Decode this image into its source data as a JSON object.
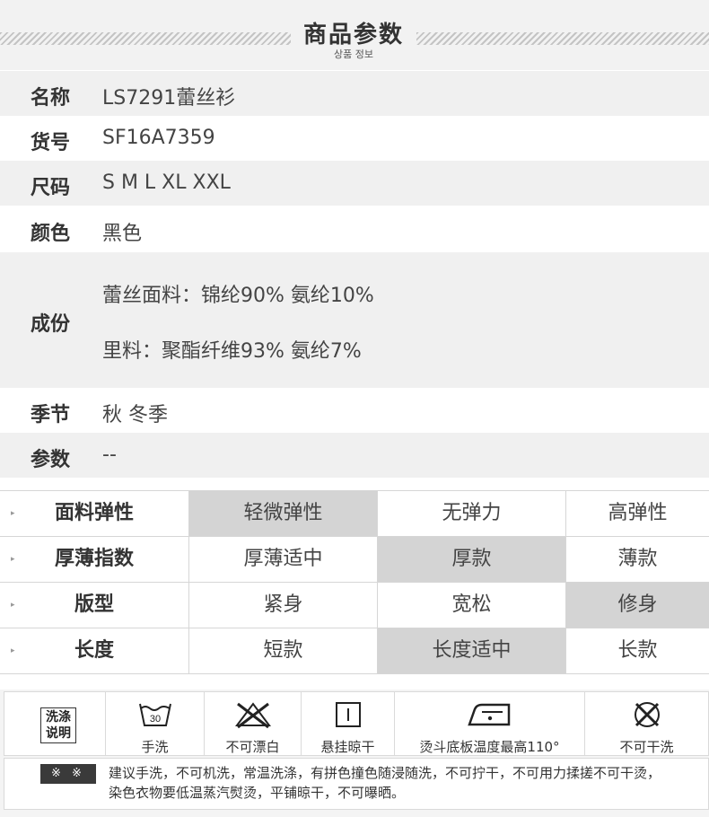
{
  "header": {
    "title": "商品参数",
    "subtitle": "상품 정보"
  },
  "info": [
    {
      "label": "名称",
      "value": "LS7291蕾丝衫"
    },
    {
      "label": "货号",
      "value": "SF16A7359"
    },
    {
      "label": "尺码",
      "value": "S M L XL XXL"
    },
    {
      "label": "颜色",
      "value": "黑色"
    },
    {
      "label": "成份",
      "lines": [
        "蕾丝面料：锦纶90% 氨纶10%",
        "里料：聚酯纤维93% 氨纶7%"
      ]
    },
    {
      "label": "季节",
      "value": "秋 冬季"
    },
    {
      "label": "参数",
      "value": "--"
    }
  ],
  "attributes": [
    {
      "name": "面料弹性",
      "options": [
        "轻微弹性",
        "无弹力",
        "高弹性"
      ],
      "selected": 0
    },
    {
      "name": "厚薄指数",
      "options": [
        "厚薄适中",
        "厚款",
        "薄款"
      ],
      "selected": 1
    },
    {
      "name": "版型",
      "options": [
        "紧身",
        "宽松",
        "修身"
      ],
      "selected": 2
    },
    {
      "name": "长度",
      "options": [
        "短款",
        "长度适中",
        "长款"
      ],
      "selected": 1
    }
  ],
  "care": {
    "badge": [
      "洗涤",
      "说明"
    ],
    "items": [
      {
        "icon": "hand-wash-30-icon",
        "icon_text": "30",
        "label": "手洗"
      },
      {
        "icon": "no-bleach-icon",
        "label": "不可漂白"
      },
      {
        "icon": "hang-dry-icon",
        "label": "悬挂晾干"
      },
      {
        "icon": "iron-icon",
        "label": "烫斗底板温度最高110°"
      },
      {
        "icon": "no-dry-clean-icon",
        "label": "不可干洗"
      }
    ],
    "note_mark": "※ ※",
    "note_lines": [
      "建议手洗，不可机洗，常温洗涤，有拼色撞色随浸随洗，不可拧干，不可用力揉搓不可干烫，",
      "染色衣物要低温蒸汽熨烫，平铺晾干，不可曝晒。"
    ]
  },
  "colors": {
    "selected": "#d4d4d4",
    "row_gray": "#f0f0f0",
    "text": "#333333"
  }
}
